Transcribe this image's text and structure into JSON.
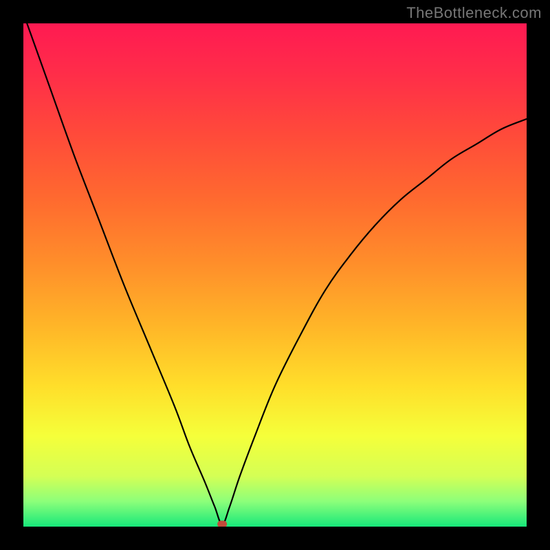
{
  "watermark": "TheBottleneck.com",
  "chart_data": {
    "type": "line",
    "title": "",
    "xlabel": "",
    "ylabel": "",
    "xlim": [
      0,
      100
    ],
    "ylim": [
      0,
      100
    ],
    "grid": false,
    "legend": false,
    "annotations": [],
    "series": [
      {
        "name": "curve",
        "x": [
          0,
          5,
          10,
          15,
          20,
          25,
          30,
          33,
          36,
          38,
          39.5,
          41,
          43,
          46,
          50,
          55,
          60,
          65,
          70,
          75,
          80,
          85,
          90,
          95,
          100
        ],
        "y": [
          102,
          88,
          74,
          61,
          48,
          36,
          24,
          16,
          9,
          4,
          0.5,
          4,
          10,
          18,
          28,
          38,
          47,
          54,
          60,
          65,
          69,
          73,
          76,
          79,
          81
        ]
      }
    ],
    "marker": {
      "x": 39.5,
      "y": 0.5,
      "color": "#c24a3a"
    },
    "background_gradient": {
      "stops": [
        {
          "offset": 0.0,
          "color": "#ff1a52"
        },
        {
          "offset": 0.1,
          "color": "#ff2d49"
        },
        {
          "offset": 0.22,
          "color": "#ff4a3a"
        },
        {
          "offset": 0.35,
          "color": "#ff6a2f"
        },
        {
          "offset": 0.48,
          "color": "#ff8f2a"
        },
        {
          "offset": 0.6,
          "color": "#ffb528"
        },
        {
          "offset": 0.72,
          "color": "#ffde2a"
        },
        {
          "offset": 0.82,
          "color": "#f5ff3a"
        },
        {
          "offset": 0.9,
          "color": "#d4ff55"
        },
        {
          "offset": 0.95,
          "color": "#8cff7a"
        },
        {
          "offset": 1.0,
          "color": "#17e87a"
        }
      ]
    }
  }
}
